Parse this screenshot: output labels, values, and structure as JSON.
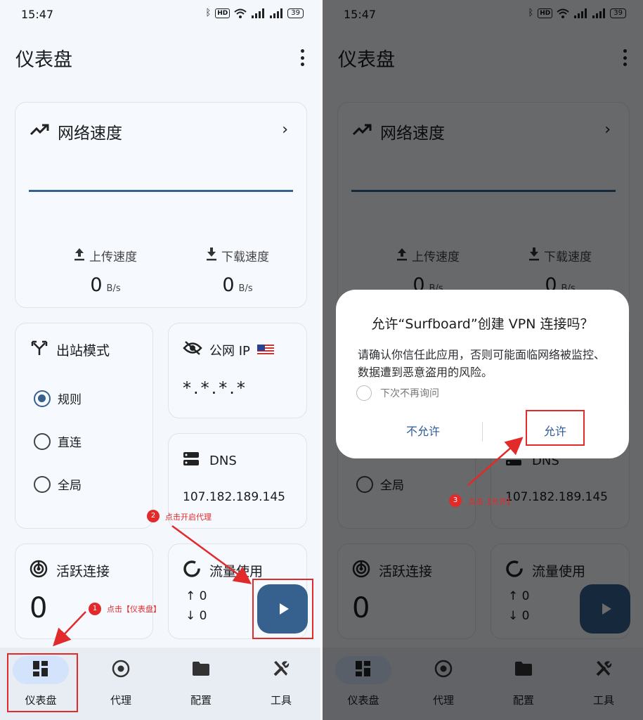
{
  "status_bar": {
    "time": "15:47",
    "hd": "HD",
    "battery": "39",
    "signal1": "5G",
    "signal2": "5G"
  },
  "app": {
    "title": "仪表盘"
  },
  "speed": {
    "title": "网络速度",
    "upload_label": "上传速度",
    "download_label": "下载速度",
    "upload_value": "0",
    "download_value": "0",
    "unit": "B/s"
  },
  "outbound": {
    "title": "出站模式",
    "options": [
      "规则",
      "直连",
      "全局"
    ],
    "selected": "规则"
  },
  "public_ip": {
    "title": "公网 IP",
    "value": "*.*.*.*"
  },
  "dns": {
    "title": "DNS",
    "value": "107.182.189.145"
  },
  "connections": {
    "title": "活跃连接",
    "value": "0"
  },
  "traffic": {
    "title": "流量使用",
    "up": "↑ 0",
    "down": "↓ 0"
  },
  "nav": {
    "items": [
      "仪表盘",
      "代理",
      "配置",
      "工具"
    ],
    "active": "仪表盘"
  },
  "annotations": {
    "step1_num": "1",
    "step1_text": "点击【仪表盘】",
    "step2_num": "2",
    "step2_text": "点击开启代理",
    "step3_num": "3",
    "step3_text": "点击【允许】"
  },
  "dialog": {
    "title": "允许“Surfboard”创建 VPN 连接吗？",
    "body": "请确认你信任此应用，否则可能面临网络被监控、数据遭到恶意盗用的风险。",
    "checkbox": "下次不再询问",
    "deny": "不允许",
    "allow": "允许"
  },
  "colors": {
    "primary": "#36618e",
    "annotation": "#e32a2a",
    "nav_active": "#d2e3fb",
    "background": "#f4f7fc"
  },
  "icons": [
    "bluetooth-icon",
    "wifi-icon",
    "signal-icon",
    "battery-icon",
    "more-vert-icon",
    "trending-icon",
    "chevron-right-icon",
    "upload-icon",
    "download-icon",
    "fork-icon",
    "eye-off-icon",
    "server-icon",
    "radar-icon",
    "donut-icon",
    "play-icon",
    "dashboard-icon",
    "proxy-icon",
    "folder-icon",
    "tools-icon"
  ]
}
